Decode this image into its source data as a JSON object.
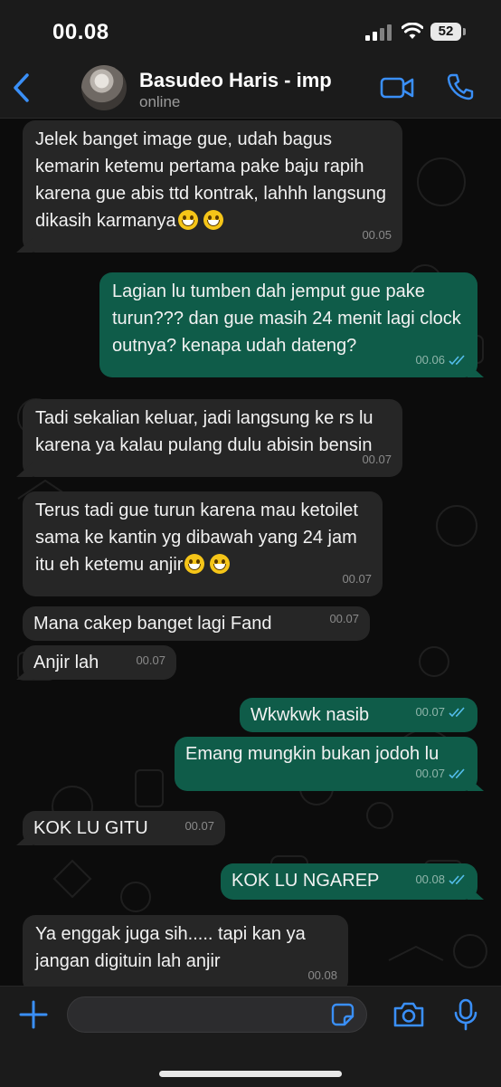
{
  "status_bar": {
    "time": "00.08",
    "battery": "52"
  },
  "header": {
    "name": "Basudeo Haris - imp",
    "status": "online"
  },
  "messages": [
    {
      "dir": "in",
      "text": "Jelek banget image gue, udah bagus kemarin ketemu pertama pake baju rapih karena gue abis ttd kontrak, lahhh langsung dikasih karmanya",
      "emoji": 2,
      "time": "00.05"
    },
    {
      "dir": "out",
      "text": "Lagian lu tumben dah jemput gue pake turun??? dan gue masih 24 menit lagi clock outnya? kenapa udah dateng?",
      "emoji": 0,
      "time": "00.06"
    },
    {
      "dir": "in",
      "text": "Tadi sekalian keluar, jadi langsung ke rs lu karena ya kalau pulang dulu abisin bensin",
      "emoji": 0,
      "time": "00.07"
    },
    {
      "dir": "in",
      "text": "Terus tadi gue turun karena mau ketoilet sama ke kantin yg dibawah yang 24 jam itu eh ketemu anjir",
      "emoji": 2,
      "time": "00.07"
    },
    {
      "dir": "in",
      "text": "Mana cakep banget lagi Fand",
      "emoji": 0,
      "time": "00.07"
    },
    {
      "dir": "in",
      "text": "Anjir lah",
      "emoji": 0,
      "time": "00.07"
    },
    {
      "dir": "out",
      "text": "Wkwkwk nasib",
      "emoji": 0,
      "time": "00.07"
    },
    {
      "dir": "out",
      "text": "Emang mungkin bukan jodoh lu",
      "emoji": 0,
      "time": "00.07"
    },
    {
      "dir": "in",
      "text": "KOK LU GITU",
      "emoji": 0,
      "time": "00.07"
    },
    {
      "dir": "out",
      "text": "KOK LU NGAREP",
      "emoji": 0,
      "time": "00.08"
    },
    {
      "dir": "in",
      "text": "Ya enggak juga sih..... tapi kan ya jangan digituin lah anjir",
      "emoji": 0,
      "time": "00.08"
    }
  ],
  "composer": {
    "value": "",
    "placeholder": ""
  },
  "colors": {
    "accent": "#3a8ff7",
    "incoming_bubble": "#262626",
    "outgoing_bubble": "#0f5c49",
    "read_ticks": "#53bdeb"
  },
  "icons": [
    "back-chevron-icon",
    "video-call-icon",
    "phone-icon",
    "plus-icon",
    "sticker-icon",
    "camera-icon",
    "microphone-icon"
  ]
}
